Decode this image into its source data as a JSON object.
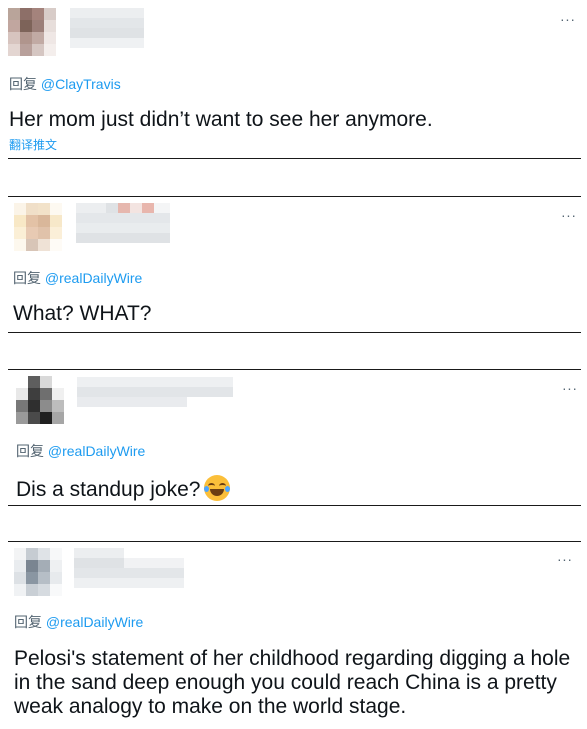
{
  "reply_prefix": "回复",
  "more_glyph": "···",
  "tweets": [
    {
      "reply_to": "@ClayTravis",
      "text": "Her mom just didn’t want to see her anymore.",
      "translate": "翻译推文"
    },
    {
      "reply_to": "@realDailyWire",
      "text": "What? WHAT?"
    },
    {
      "reply_to": "@realDailyWire",
      "text": "Dis a standup joke?",
      "emoji": "face-with-tears-of-joy-icon"
    },
    {
      "reply_to": "@realDailyWire",
      "text": "Pelosi's statement of her childhood regarding digging a hole in the sand deep enough you could reach China is a pretty weak analogy to make on the world stage."
    }
  ],
  "colors": {
    "link": "#1d9bf0",
    "secondary_text": "#536471",
    "primary_text": "#0f1419",
    "divider": "#1a1a1a"
  }
}
